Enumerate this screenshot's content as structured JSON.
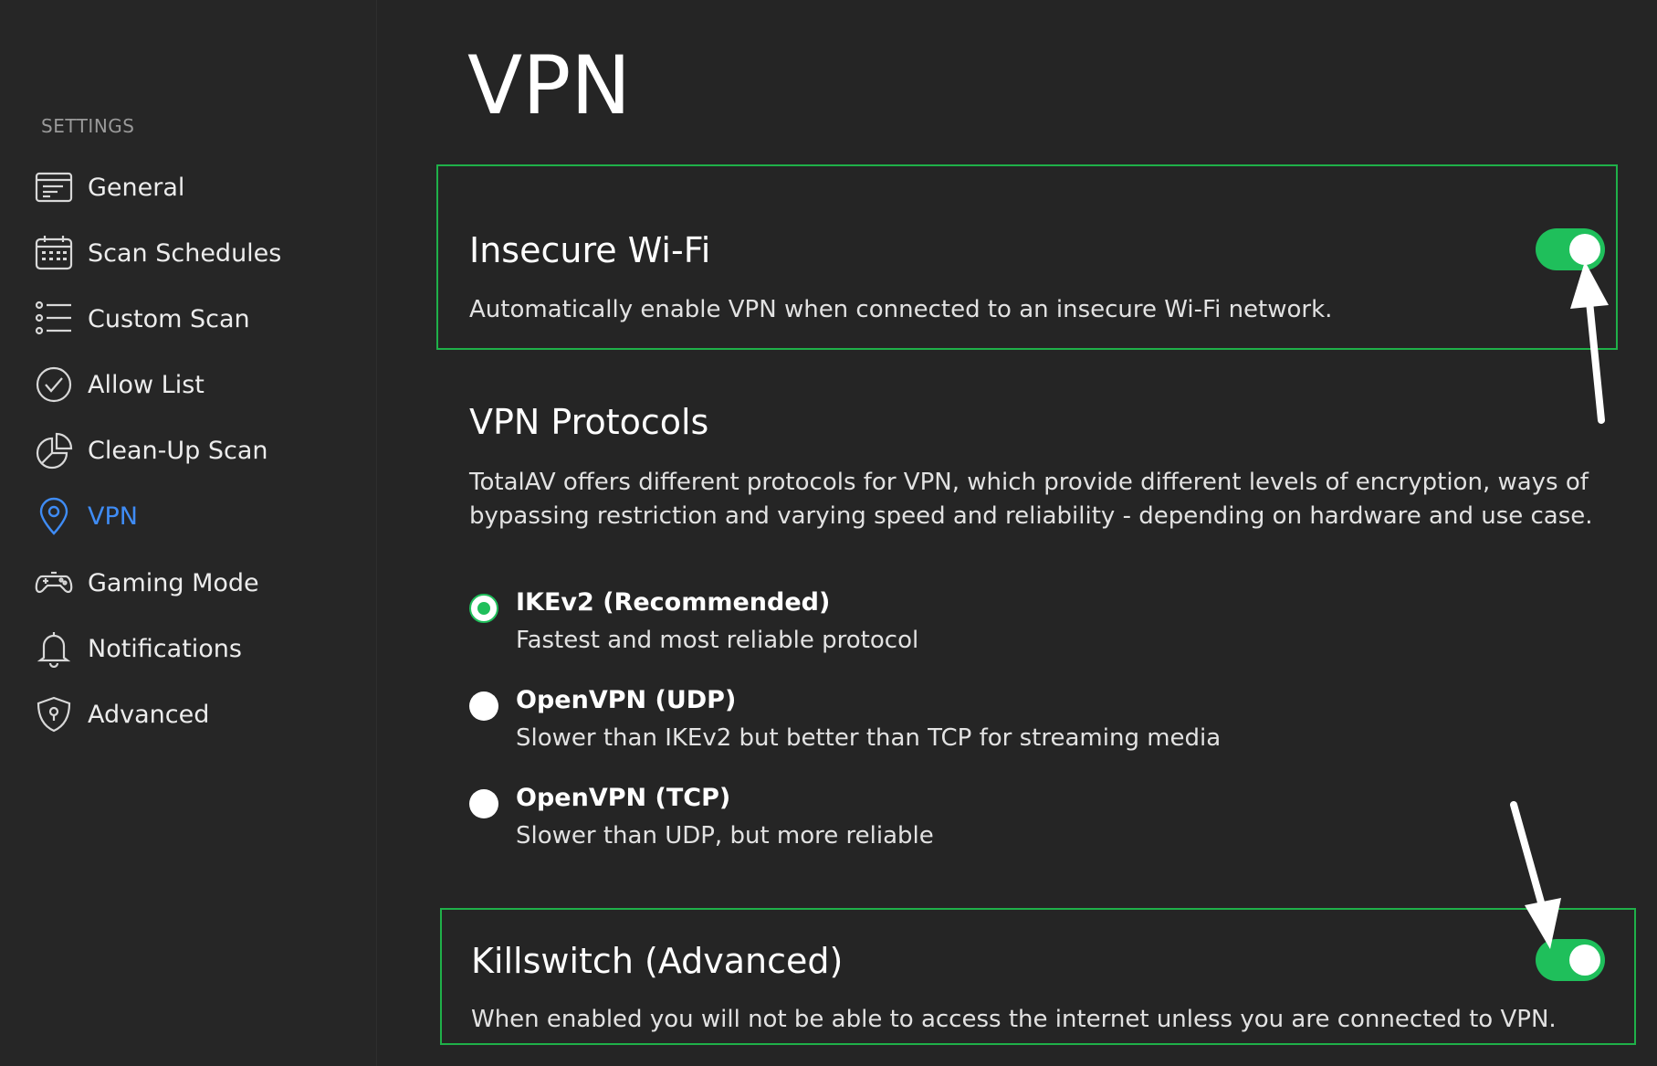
{
  "page": {
    "title": "VPN"
  },
  "sidebar": {
    "heading": "SETTINGS",
    "items": [
      {
        "label": "General",
        "icon": "general-icon"
      },
      {
        "label": "Scan Schedules",
        "icon": "calendar-icon"
      },
      {
        "label": "Custom Scan",
        "icon": "list-icon"
      },
      {
        "label": "Allow List",
        "icon": "check-circle-icon"
      },
      {
        "label": "Clean-Up Scan",
        "icon": "pie-chart-icon"
      },
      {
        "label": "VPN",
        "icon": "location-pin-icon",
        "active": true
      },
      {
        "label": "Gaming Mode",
        "icon": "gamepad-icon"
      },
      {
        "label": "Notifications",
        "icon": "bell-icon"
      },
      {
        "label": "Advanced",
        "icon": "shield-lock-icon"
      }
    ]
  },
  "insecure_wifi": {
    "title": "Insecure Wi-Fi",
    "description": "Automatically enable VPN when connected to an insecure Wi-Fi network.",
    "enabled": true
  },
  "protocols": {
    "title": "VPN Protocols",
    "description": "TotalAV offers different protocols for VPN, which provide different levels of encryption, ways of bypassing restriction and varying speed and reliability - depending on hardware and use case.",
    "options": [
      {
        "label": "IKEv2 (Recommended)",
        "description": "Fastest and most reliable protocol",
        "selected": true
      },
      {
        "label": "OpenVPN (UDP)",
        "description": "Slower than IKEv2 but better than TCP for streaming media",
        "selected": false
      },
      {
        "label": "OpenVPN (TCP)",
        "description": "Slower than UDP, but more reliable",
        "selected": false
      }
    ]
  },
  "killswitch": {
    "title": "Killswitch (Advanced)",
    "description": "When enabled you will not be able to access the internet unless you are connected to VPN.",
    "enabled": true
  },
  "colors": {
    "accent_green": "#1fbf5b",
    "highlight_border": "#1fb049",
    "active_nav": "#3f8cf5",
    "background": "#252525"
  }
}
